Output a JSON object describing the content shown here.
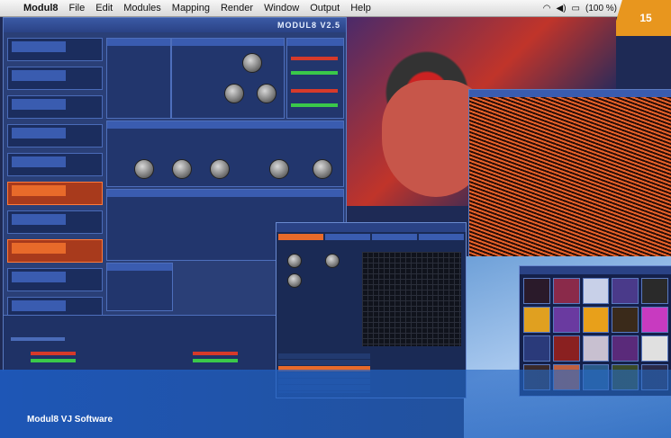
{
  "menubar": {
    "app_name": "Modul8",
    "items": [
      "File",
      "Edit",
      "Modules",
      "Mapping",
      "Render",
      "Window",
      "Output",
      "Help"
    ],
    "status_text": "(100 %)"
  },
  "page_number": "15",
  "window": {
    "title": "MODUL8 V2.5"
  },
  "caption": "Modul8 VJ Software",
  "colors": {
    "accent_orange": "#e86a2a",
    "panel_blue": "#2a3f77",
    "badge_orange": "#e8961e"
  },
  "icons": [
    "apple-icon",
    "wifi-icon",
    "volume-icon",
    "battery-icon"
  ]
}
